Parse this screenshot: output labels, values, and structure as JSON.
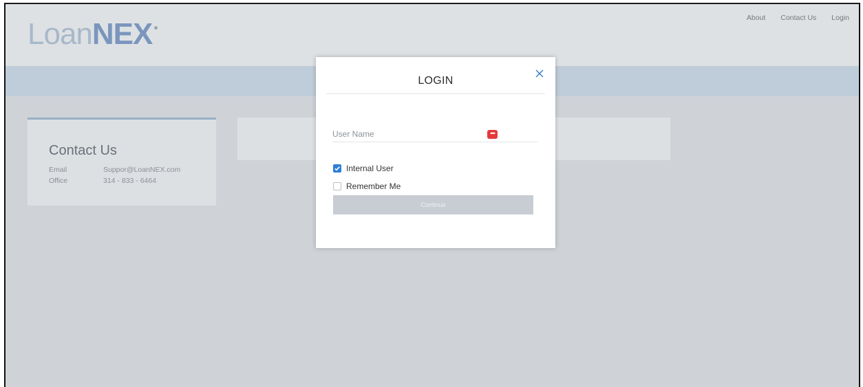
{
  "brand": {
    "logo_light": "Loan",
    "logo_bold": "NEX"
  },
  "nav": [
    {
      "label": "About"
    },
    {
      "label": "Contact Us"
    },
    {
      "label": "Login"
    }
  ],
  "contact": {
    "title": "Contact Us",
    "email_label": "Email",
    "email_value": "Suppor@LoanNEX.com",
    "office_label": "Office",
    "office_value": "314 - 833 - 6464"
  },
  "login_modal": {
    "title": "LOGIN",
    "username_placeholder": "User Name",
    "username_value": "",
    "internal_user_label": "Internal User",
    "internal_user_checked": true,
    "remember_me_label": "Remember Me",
    "remember_me_checked": false,
    "continue_label": "Continue"
  },
  "colors": {
    "accent": "#2f7fd8",
    "brand_blue": "#7b96bd",
    "badge_red": "#e63a3a"
  },
  "icons": {
    "close": "close-icon",
    "password_manager": "password-manager-icon",
    "check": "check-icon"
  }
}
